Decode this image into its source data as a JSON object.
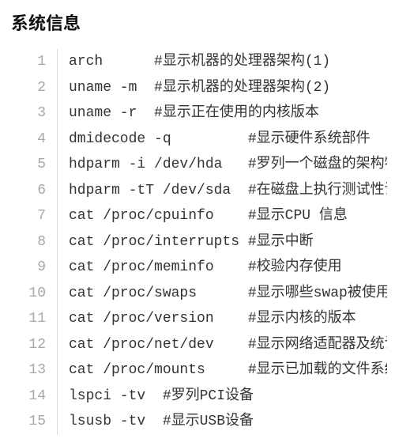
{
  "heading": "系统信息",
  "code_lines": [
    "arch      #显示机器的处理器架构(1)",
    "uname -m  #显示机器的处理器架构(2)",
    "uname -r  #显示正在使用的内核版本",
    "dmidecode -q         #显示硬件系统部件",
    "hdparm -i /dev/hda   #罗列一个磁盘的架构特性",
    "hdparm -tT /dev/sda  #在磁盘上执行测试性读取操作",
    "cat /proc/cpuinfo    #显示CPU 信息",
    "cat /proc/interrupts #显示中断",
    "cat /proc/meminfo    #校验内存使用",
    "cat /proc/swaps      #显示哪些swap被使用",
    "cat /proc/version    #显示内核的版本",
    "cat /proc/net/dev    #显示网络适配器及统计",
    "cat /proc/mounts     #显示已加载的文件系统",
    "lspci -tv  #罗列PCI设备",
    "lsusb -tv  #显示USB设备"
  ]
}
